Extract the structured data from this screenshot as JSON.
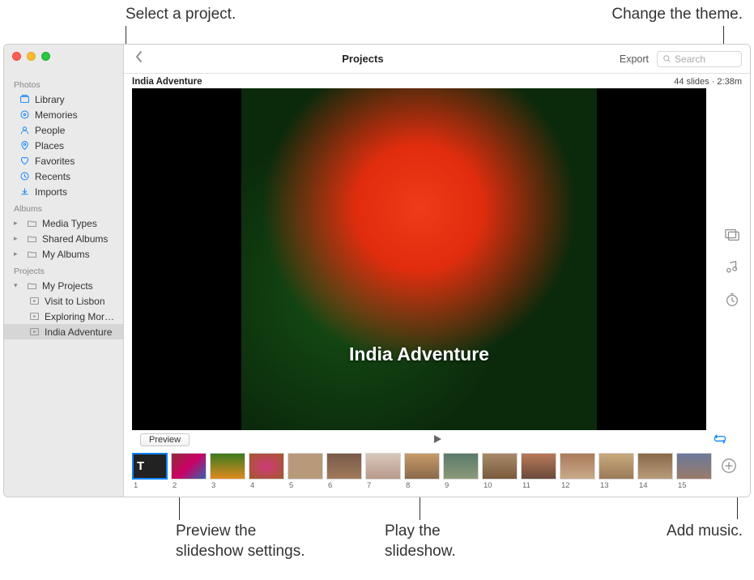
{
  "callouts": {
    "select_project": "Select a project.",
    "change_theme": "Change the theme.",
    "preview_settings_l1": "Preview the",
    "preview_settings_l2": "slideshow settings.",
    "play_slideshow_l1": "Play the",
    "play_slideshow_l2": "slideshow.",
    "add_music": "Add music."
  },
  "toolbar": {
    "title": "Projects",
    "export": "Export",
    "search_placeholder": "Search"
  },
  "sidebar": {
    "sec_photos": "Photos",
    "sec_albums": "Albums",
    "sec_projects": "Projects",
    "photos": {
      "library": "Library",
      "memories": "Memories",
      "people": "People",
      "places": "Places",
      "favorites": "Favorites",
      "recents": "Recents",
      "imports": "Imports"
    },
    "albums": {
      "media_types": "Media Types",
      "shared_albums": "Shared Albums",
      "my_albums": "My Albums"
    },
    "projects": {
      "my_projects": "My Projects",
      "visit_lisbon": "Visit to Lisbon",
      "exploring": "Exploring Mor…",
      "india": "India Adventure"
    }
  },
  "header": {
    "project_title": "India Adventure",
    "meta": "44 slides · 2:38m"
  },
  "overlay_title": "India Adventure",
  "controls": {
    "preview": "Preview"
  },
  "filmstrip": {
    "title_mark": "T",
    "nums": [
      "1",
      "2",
      "3",
      "4",
      "5",
      "6",
      "7",
      "8",
      "9",
      "10",
      "11",
      "12",
      "13",
      "14",
      "15"
    ]
  }
}
